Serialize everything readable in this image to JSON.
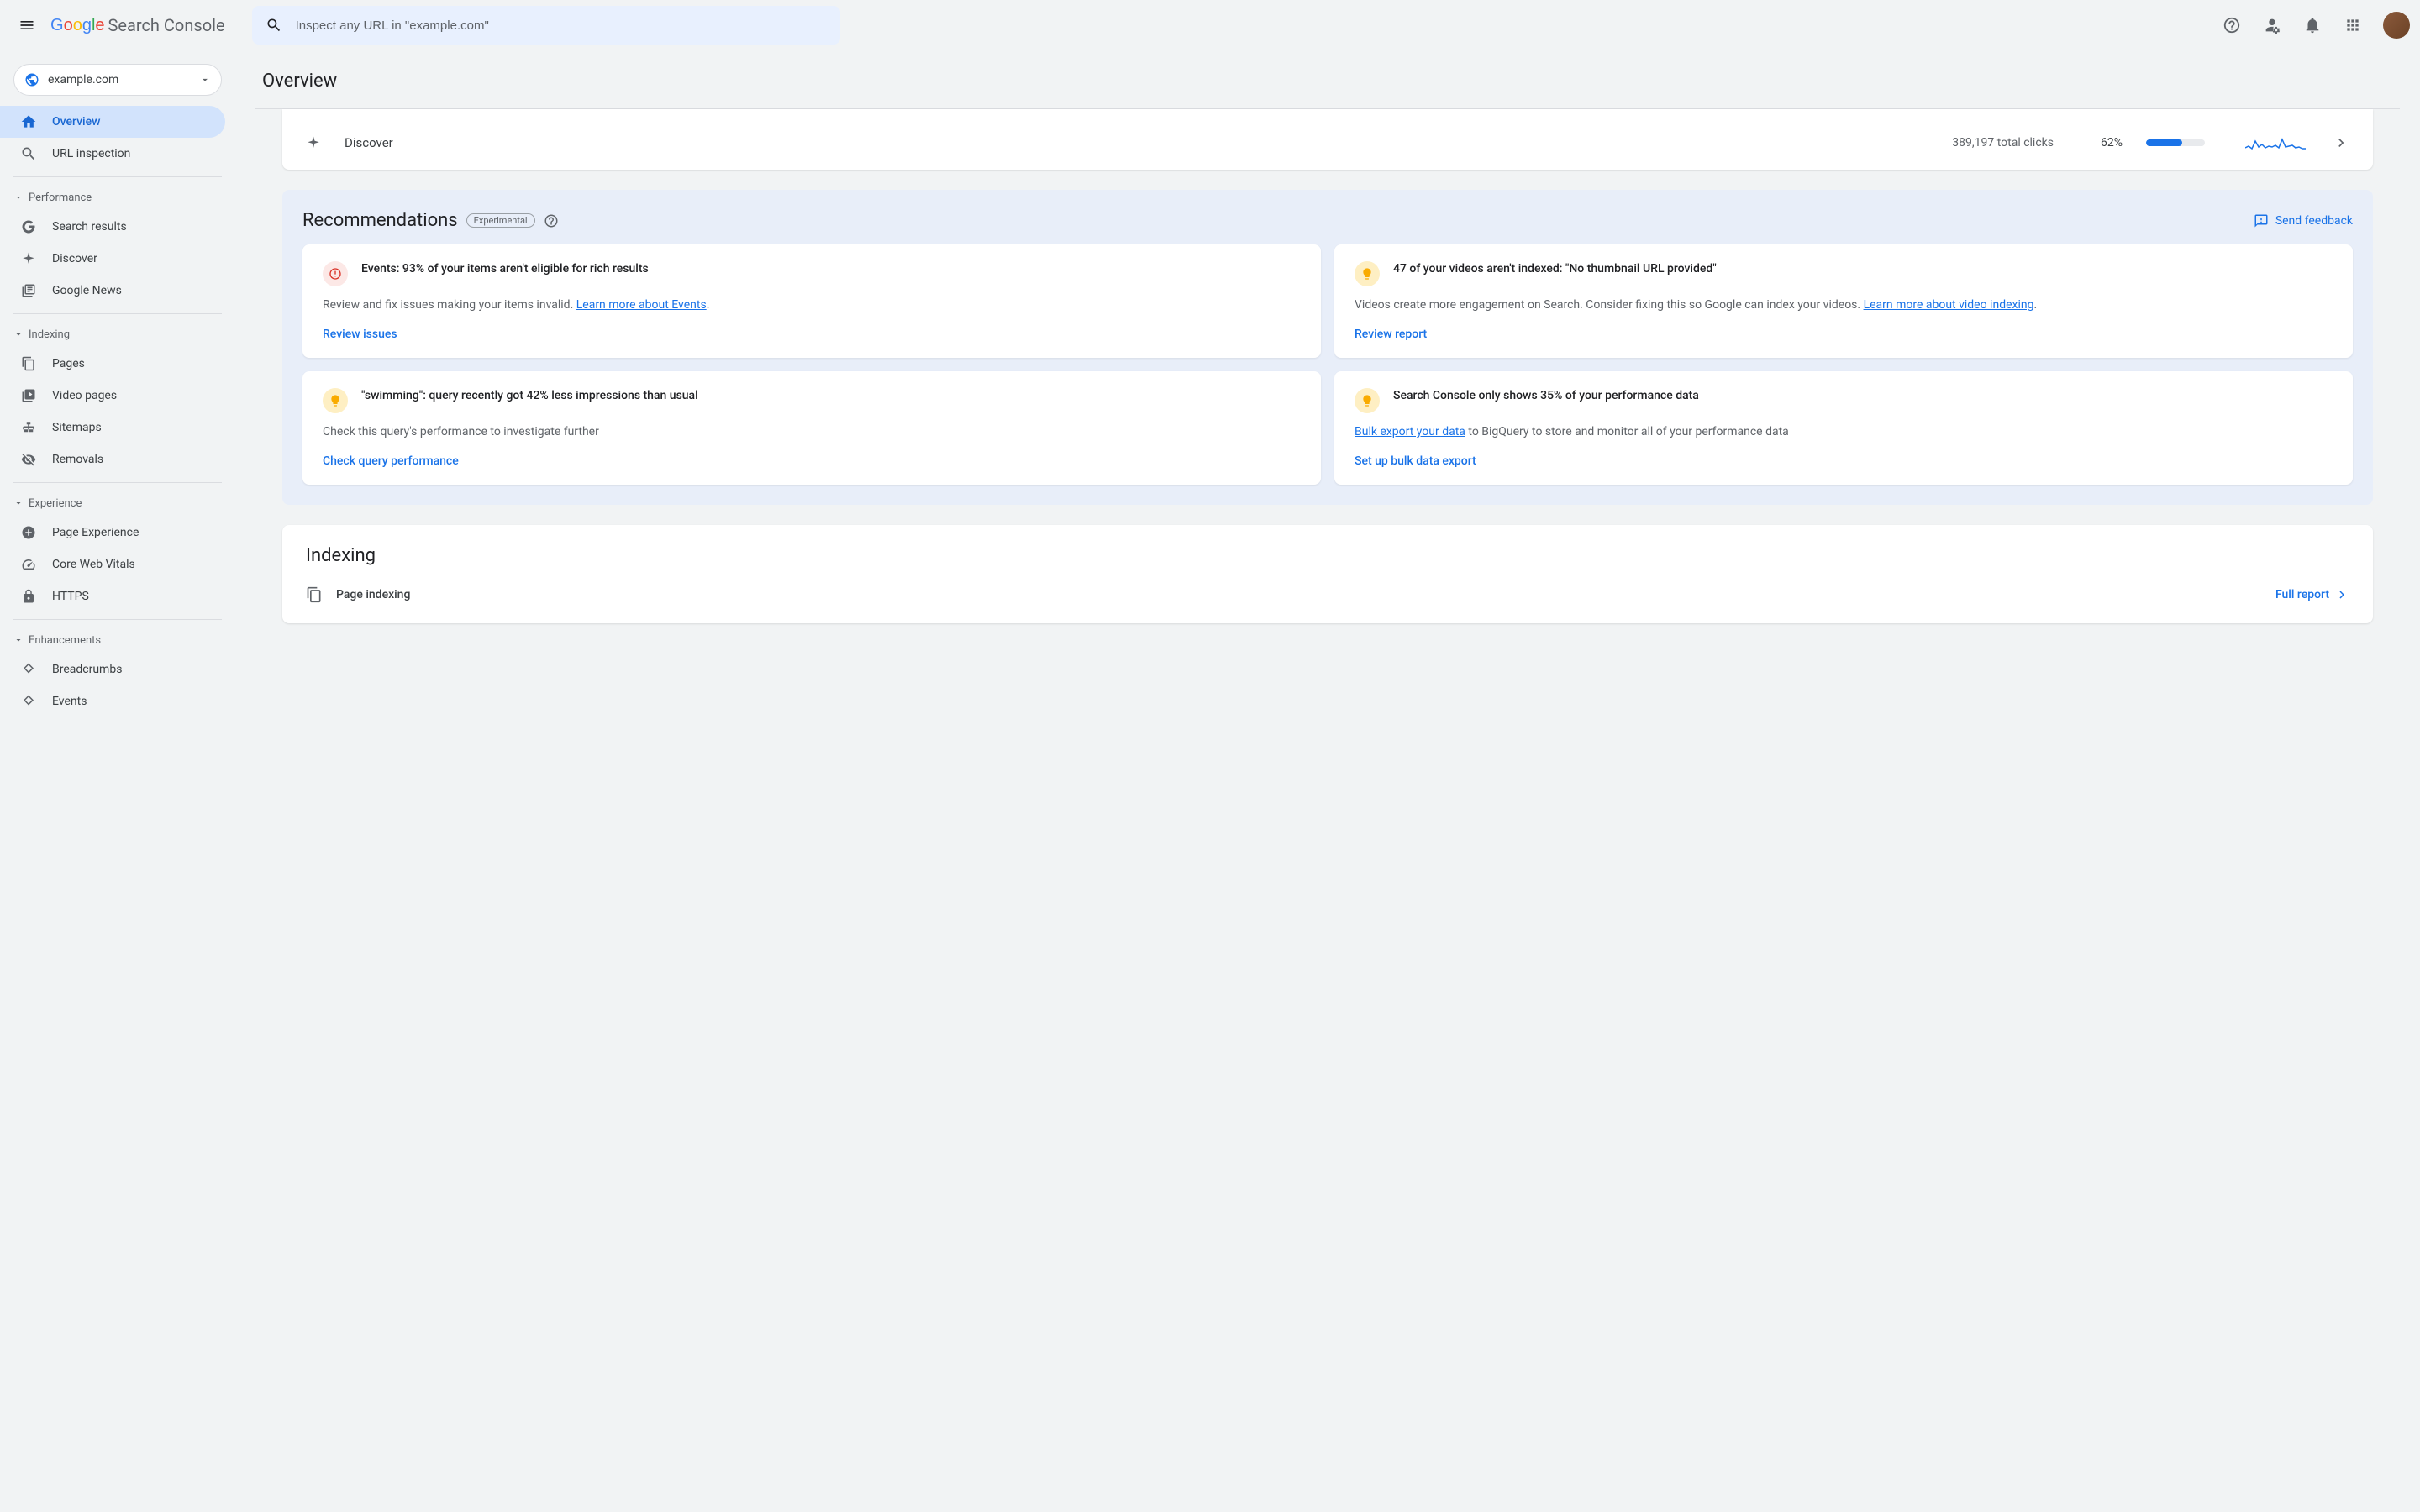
{
  "brand": {
    "google": "Google",
    "product": "Search Console"
  },
  "search": {
    "placeholder": "Inspect any URL in \"example.com\""
  },
  "property": {
    "name": "example.com"
  },
  "sidebar": {
    "items": {
      "overview": "Overview",
      "url": "URL inspection",
      "search": "Search results",
      "discover": "Discover",
      "news": "Google News",
      "pages": "Pages",
      "video": "Video pages",
      "sitemaps": "Sitemaps",
      "removals": "Removals",
      "px": "Page Experience",
      "cwv": "Core Web Vitals",
      "https": "HTTPS",
      "bread": "Breadcrumbs",
      "events": "Events"
    },
    "groups": {
      "performance": "Performance",
      "indexing": "Indexing",
      "experience": "Experience",
      "enhancements": "Enhancements"
    }
  },
  "page": {
    "title": "Overview"
  },
  "discover": {
    "label": "Discover",
    "clicks": "389,197 total clicks",
    "pct": "62%",
    "pct_val": 62
  },
  "reco": {
    "title": "Recommendations",
    "badge": "Experimental",
    "feedback": "Send feedback",
    "cards": [
      {
        "title": "Events: 93% of your items aren't eligible for rich results",
        "body_pre": "Review and fix issues making your items invalid. ",
        "link": "Learn more about Events",
        "body_post": ".",
        "action": "Review issues",
        "icon": "error"
      },
      {
        "title": "47 of your videos aren't indexed: \"No thumbnail URL provided\"",
        "body_pre": "Videos create more engagement on Search. Consider fixing this so Google can index your videos. ",
        "link": "Learn more about video indexing",
        "body_post": ".",
        "action": "Review report",
        "icon": "tip"
      },
      {
        "title": "\"swimming\": query recently got 42% less impressions than usual",
        "body_pre": "Check this query's performance to investigate further",
        "link": "",
        "body_post": "",
        "action": "Check query performance",
        "icon": "tip"
      },
      {
        "title": "Search Console only shows 35% of your performance data",
        "body_pre": "",
        "link": "Bulk export your data",
        "body_post": " to BigQuery to store and monitor all of your performance data",
        "action": "Set up bulk data export",
        "icon": "tip"
      }
    ]
  },
  "indexing": {
    "title": "Indexing",
    "row_label": "Page indexing",
    "full_report": "Full report"
  },
  "colors": {
    "accent": "#1a73e8"
  }
}
